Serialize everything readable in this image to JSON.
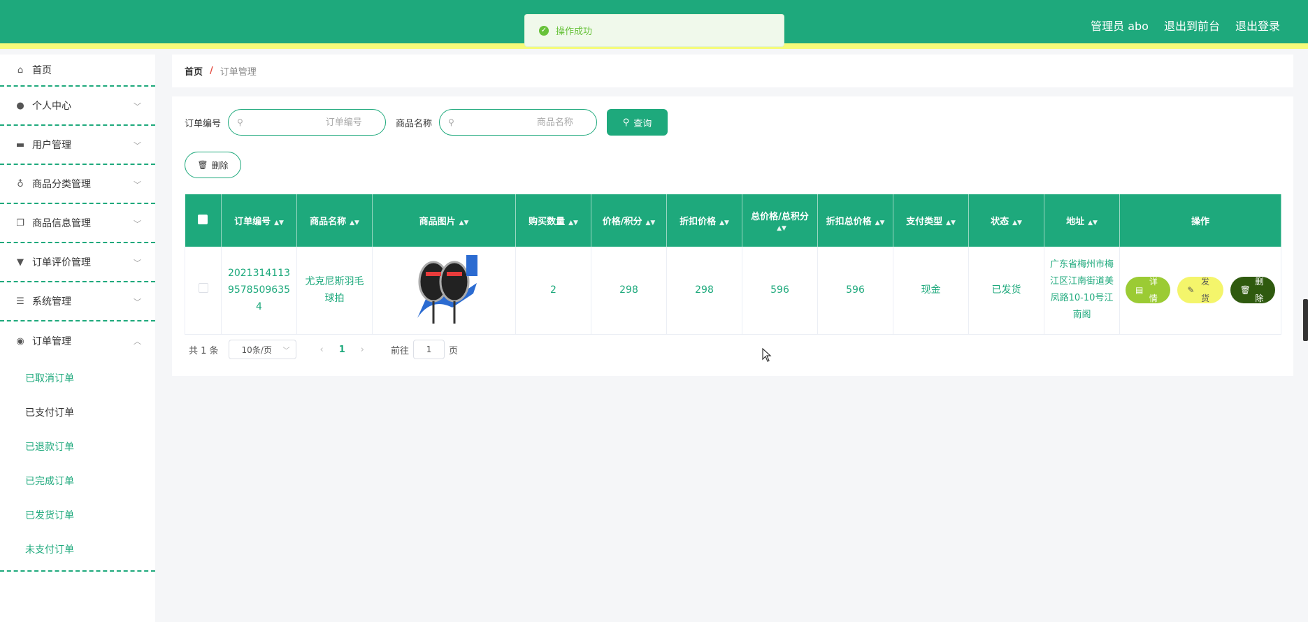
{
  "header": {
    "admin_label": "管理员 abo",
    "front_label": "退出到前台",
    "logout_label": "退出登录"
  },
  "toast": {
    "message": "操作成功"
  },
  "sidebar": {
    "items": [
      {
        "label": "首页",
        "icon": "home-icon"
      },
      {
        "label": "个人中心",
        "icon": "user-icon"
      },
      {
        "label": "用户管理",
        "icon": "users-icon"
      },
      {
        "label": "商品分类管理",
        "icon": "microphone-icon"
      },
      {
        "label": "商品信息管理",
        "icon": "copy-icon"
      },
      {
        "label": "订单评价管理",
        "icon": "brush-icon"
      },
      {
        "label": "系统管理",
        "icon": "list-icon"
      },
      {
        "label": "订单管理",
        "icon": "bulb-icon"
      }
    ],
    "order_submenu": [
      {
        "label": "已取消订单"
      },
      {
        "label": "已支付订单"
      },
      {
        "label": "已退款订单"
      },
      {
        "label": "已完成订单"
      },
      {
        "label": "已发货订单"
      },
      {
        "label": "未支付订单"
      }
    ]
  },
  "breadcrumb": {
    "home": "首页",
    "separator": "/",
    "current": "订单管理"
  },
  "search": {
    "order_no_label": "订单编号",
    "order_no_placeholder": "订单编号",
    "product_label": "商品名称",
    "product_placeholder": "商品名称",
    "query_label": "查询",
    "delete_label": "删除"
  },
  "table": {
    "columns": [
      "订单编号",
      "商品名称",
      "商品图片",
      "购买数量",
      "价格/积分",
      "折扣价格",
      "总价格/总积分",
      "折扣总价格",
      "支付类型",
      "状态",
      "地址",
      "操作"
    ],
    "rows": [
      {
        "order_no": "20213141139578509635 4",
        "product": "尤克尼斯羽毛球拍",
        "qty": "2",
        "price": "298",
        "discount_price": "298",
        "total": "596",
        "discount_total": "596",
        "pay_type": "现金",
        "status": "已发货",
        "address": "广东省梅州市梅江区江南街道美凤路10-10号江南阁",
        "op_detail": "详情",
        "op_ship": "发货",
        "op_delete": "删除"
      }
    ]
  },
  "pager": {
    "total": "共 1 条",
    "page_size": "10条/页",
    "current_page": "1",
    "goto_prefix": "前往",
    "goto_value": "1",
    "goto_suffix": "页"
  },
  "colors": {
    "primary": "#1ea97c",
    "accent_strip": "#f5fb7a",
    "detail": "#9bcb34",
    "ship": "#f4f56b",
    "delete": "#2f5a0f"
  }
}
